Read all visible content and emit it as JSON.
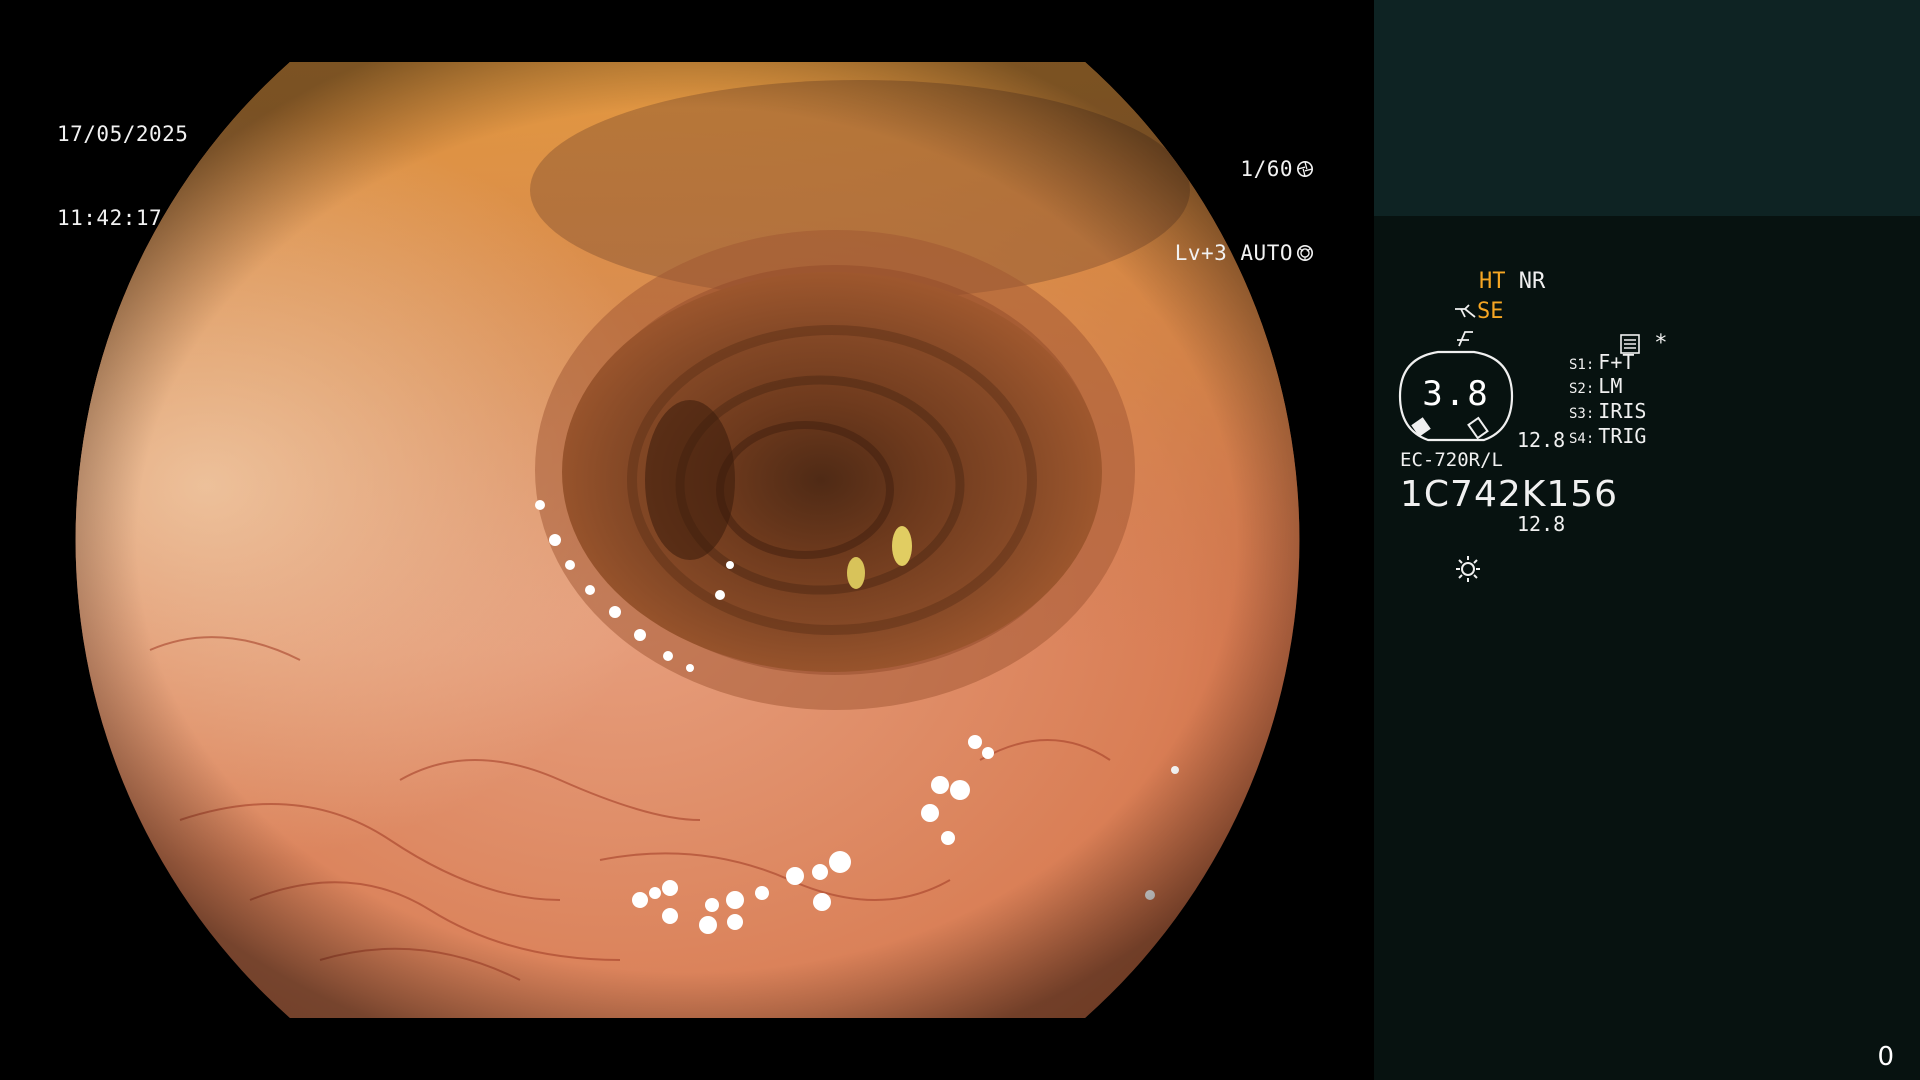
{
  "video": {
    "date": "17/05/2025",
    "time": "11:42:17",
    "shutter": "1/60",
    "shutter_icon": "aperture-icon",
    "iris_mode": "Lv+3 AUTO",
    "iris_icon": "iris-icon"
  },
  "panel": {
    "ht_label": "HT",
    "nr_label": "NR",
    "se_label": "SE",
    "se_icon": "structure-enhancement-icon",
    "color_icon": "color-mode-icon",
    "menu_icon": "menu-icon",
    "asterisk": "*",
    "gauge_value": "3.8",
    "side_values": [
      "12.8",
      "12.8"
    ],
    "switches": [
      {
        "key": "S1:",
        "value": "F+T"
      },
      {
        "key": "S2:",
        "value": "LM"
      },
      {
        "key": "S3:",
        "value": "IRIS"
      },
      {
        "key": "S4:",
        "value": "TRIG"
      }
    ],
    "model": "EC-720R/L",
    "serial": "1C742K156",
    "light_icon": "light-sun-icon",
    "counter": "0",
    "colors": {
      "accent": "#f6a623",
      "panel_bg": "#071210",
      "panel_top_bg": "#0e2323"
    }
  }
}
